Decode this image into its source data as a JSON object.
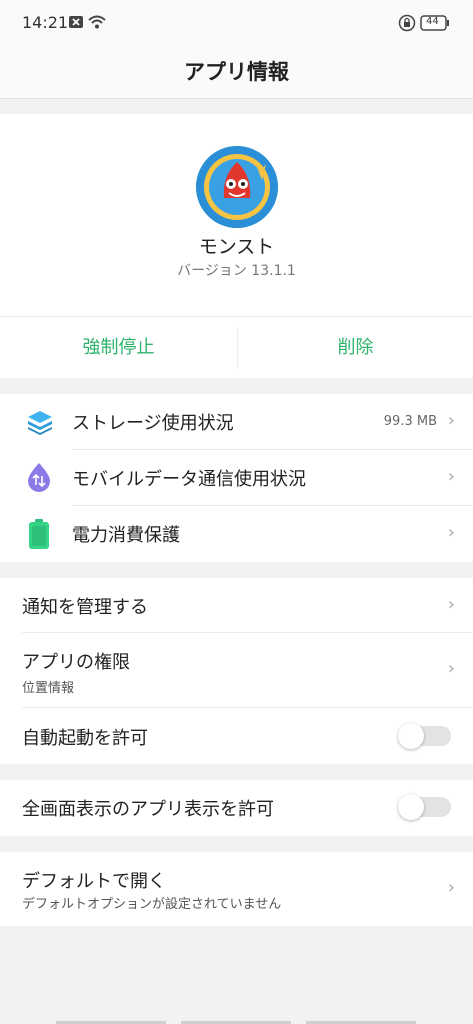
{
  "status_bar": {
    "time": "14:21",
    "battery": "44",
    "icons": [
      "close-icon",
      "wifi-icon",
      "lock-rotation-icon",
      "battery-icon"
    ]
  },
  "app_bar": {
    "title": "アプリ情報"
  },
  "app": {
    "icon": "monster-strike-app-icon",
    "name": "モンスト",
    "version": "バージョン 13.1.1"
  },
  "actions": {
    "force_stop": "強制停止",
    "uninstall": "削除"
  },
  "usage": [
    {
      "label": "ストレージ使用状況",
      "value": "99.3 MB",
      "icon": "storage-layers-icon"
    },
    {
      "label": "モバイルデータ通信使用状況",
      "value": "",
      "icon": "mobile-data-icon"
    },
    {
      "label": "電力消費保護",
      "value": "",
      "icon": "battery-icon"
    }
  ],
  "settings": {
    "notifications": "通知を管理する",
    "permissions": {
      "label": "アプリの権限",
      "sub": "位置情報"
    },
    "auto_launch": {
      "label": "自動起動を許可",
      "enabled": false
    },
    "overlay": {
      "label": "全画面表示のアプリ表示を許可",
      "enabled": false
    },
    "open_by_default": {
      "label": "デフォルトで開く",
      "sub": "デフォルトオプションが設定されていません"
    }
  },
  "colors": {
    "accent": "#2db36b",
    "background": "#f2f2f2"
  }
}
